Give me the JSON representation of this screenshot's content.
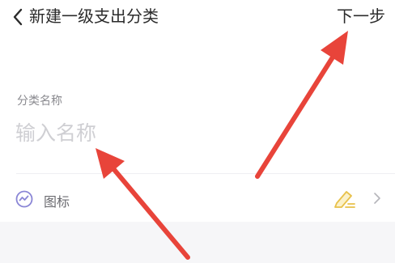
{
  "header": {
    "title": "新建一级支出分类",
    "next_label": "下一步",
    "back_icon": "chevron-left-icon"
  },
  "form": {
    "name_label": "分类名称",
    "name_placeholder": "输入名称",
    "name_value": ""
  },
  "icon_row": {
    "label": "图标",
    "left_icon": "chart-circle-icon",
    "right_icon": "pencil-icon",
    "chevron_icon": "chevron-right-icon"
  },
  "colors": {
    "background": "#f6f6f8",
    "surface": "#ffffff",
    "accent_yellow": "#e8c14a",
    "icon_purple": "#8a86d6",
    "annotation_red": "#e8443a"
  }
}
